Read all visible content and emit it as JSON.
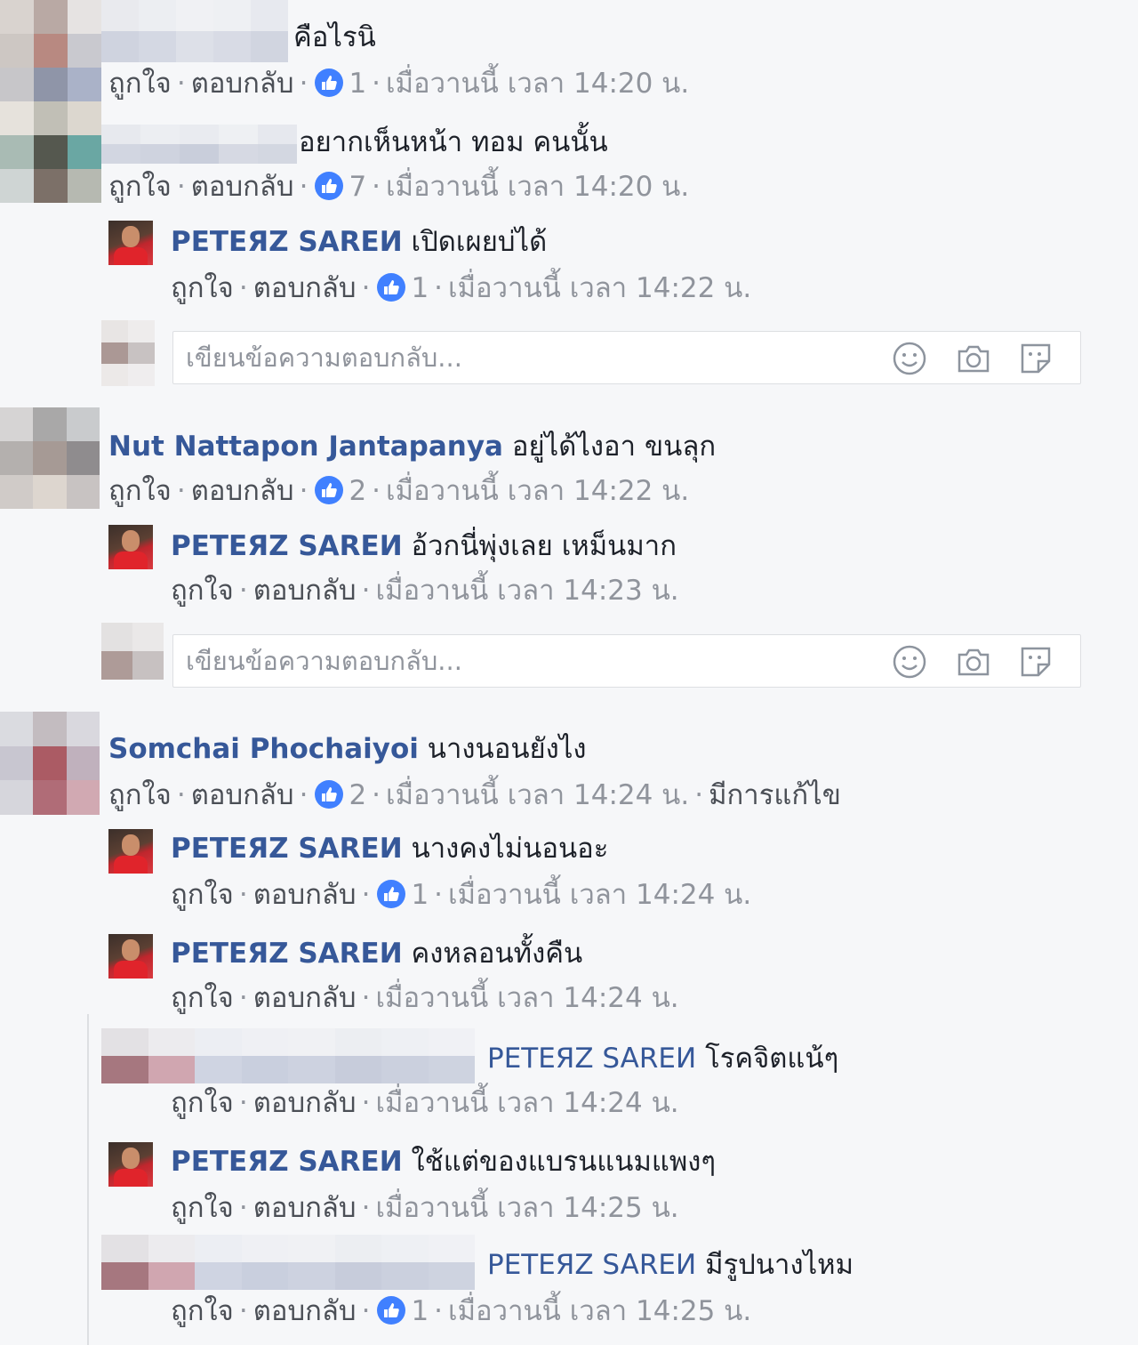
{
  "common": {
    "like": "ถูกใจ",
    "reply": "ตอบกลับ",
    "dot": "·",
    "reply_placeholder": "เขียนข้อความตอบกลับ...",
    "like_color": "#4080ff",
    "name_color": "#365899"
  },
  "comments": [
    {
      "author": "",
      "text": "คือไรนิ",
      "likes": "1",
      "time": "เมื่อวานนี้ เวลา 14:20 น."
    },
    {
      "author": "",
      "text": "อยากเห็นหน้า ทอม คนนั้น",
      "likes": "7",
      "time": "เมื่อวานนี้ เวลา 14:20 น."
    },
    {
      "author": "PETEЯZ SAREИ",
      "text": "เปิดเผยบ่ได้",
      "likes": "1",
      "time": "เมื่อวานนี้ เวลา 14:22 น."
    },
    {
      "author": "Nut Nattapon Jantapanya",
      "text": "อยู่ได้ไงอา ขนลุก",
      "likes": "2",
      "time": "เมื่อวานนี้ เวลา 14:22 น."
    },
    {
      "author": "PETEЯZ SAREИ",
      "text": "อ้วกนี่พุ่งเลย เหม็นมาก",
      "time": "เมื่อวานนี้ เวลา 14:23 น."
    },
    {
      "author": "Somchai Phochaiyoi",
      "text": "นางนอนยังไง",
      "likes": "2",
      "time": "เมื่อวานนี้ เวลา 14:24 น.",
      "edited": "มีการแก้ไข"
    },
    {
      "author": "PETEЯZ SAREИ",
      "text": "นางคงไม่นอนอะ",
      "likes": "1",
      "time": "เมื่อวานนี้ เวลา 14:24 น."
    },
    {
      "author": "PETEЯZ SAREИ",
      "text": "คงหลอนทั้งคืน",
      "time": "เมื่อวานนี้ เวลา 14:24 น."
    },
    {
      "author": "PETEЯZ SAREИ",
      "text": "โรคจิตแน้ๆ",
      "time": "เมื่อวานนี้ เวลา 14:24 น."
    },
    {
      "author": "PETEЯZ SAREИ",
      "text": "ใช้แต่ของแบรนแนมแพงๆ",
      "time": "เมื่อวานนี้ เวลา 14:25 น."
    },
    {
      "author": "PETEЯZ SAREИ",
      "text": "มีรูปนางไหม",
      "likes": "1",
      "time": "เมื่อวานนี้ เวลา 14:25 น."
    }
  ]
}
